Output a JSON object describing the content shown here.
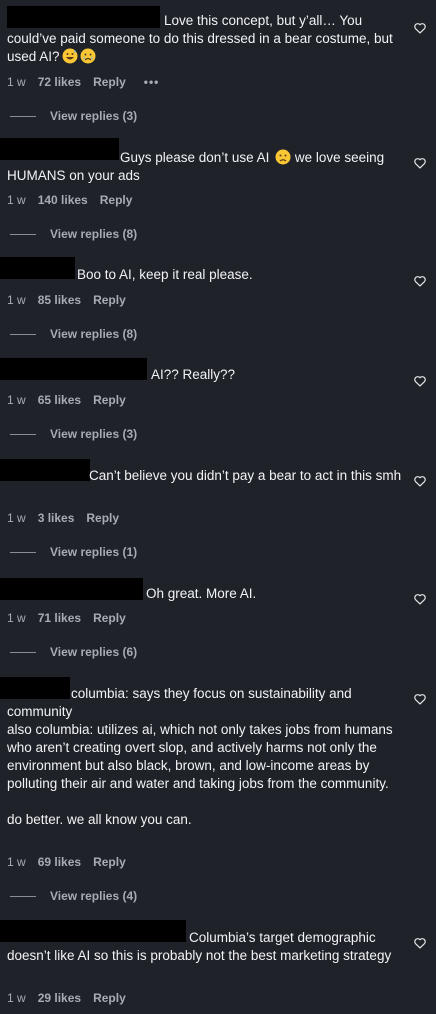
{
  "comments": [
    {
      "text": "Love this concept, but y’all… You could’ve paid someone to do this dressed in a bear costume, but used AI?",
      "emojis": [
        "grinning-sweat-face",
        "crying-face"
      ],
      "time": "1 w",
      "likes": "72 likes",
      "reply_label": "Reply",
      "more_label": "•••",
      "replies_label": "View replies (3)"
    },
    {
      "text": "Guys please don’t use AI",
      "text_after_emoji": " we love seeing HUMANS on your ads",
      "emojis": [
        "worried-face"
      ],
      "time": "1 w",
      "likes": "140 likes",
      "reply_label": "Reply",
      "replies_label": "View replies (8)"
    },
    {
      "text": "Boo to AI, keep it real please.",
      "time": "1 w",
      "likes": "85 likes",
      "reply_label": "Reply",
      "replies_label": "View replies (8)"
    },
    {
      "text": "AI?? Really??",
      "time": "1 w",
      "likes": "65 likes",
      "reply_label": "Reply",
      "replies_label": "View replies (3)"
    },
    {
      "text": "Can’t believe you didn’t pay a bear to act in this smh",
      "time": "1 w",
      "likes": "3 likes",
      "reply_label": "Reply",
      "replies_label": "View replies (1)"
    },
    {
      "text": "Oh great. More AI.",
      "time": "1 w",
      "likes": "71 likes",
      "reply_label": "Reply",
      "replies_label": "View replies (6)"
    },
    {
      "text": "columbia: says they focus on sustainability and community\nalso columbia: utilizes ai, which not only takes jobs from humans who aren’t creating overt slop, and actively harms not only the environment but also black, brown, and low-income areas by polluting their air and water and taking jobs from the community.\n\ndo better. we all know you can.",
      "time": "1 w",
      "likes": "69 likes",
      "reply_label": "Reply",
      "replies_label": "View replies (4)"
    },
    {
      "text": "Columbia’s target demographic doesn’t like AI so this is probably not the best marketing strategy",
      "time": "1 w",
      "likes": "29 likes",
      "reply_label": "Reply"
    }
  ],
  "colors": {
    "background": "#1f2329",
    "text": "#f2f3f5",
    "muted": "#a8abb2",
    "redaction": "#000000"
  }
}
